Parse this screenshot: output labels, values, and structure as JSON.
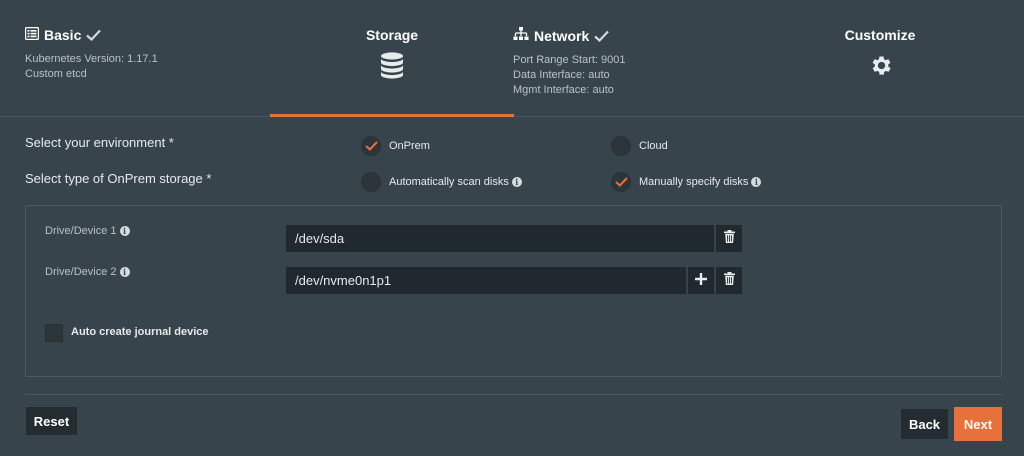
{
  "steps": [
    {
      "title": "Basic",
      "icon": "list-icon",
      "completed": true,
      "details": [
        "Kubernetes Version: 1.17.1",
        "Custom etcd"
      ]
    },
    {
      "title": "Storage",
      "icon": "database-icon",
      "active": true,
      "details": []
    },
    {
      "title": "Network",
      "icon": "sitemap-icon",
      "completed": true,
      "details": [
        "Port Range Start: 9001",
        "Data Interface: auto",
        "Mgmt Interface: auto"
      ]
    },
    {
      "title": "Customize",
      "icon": "gear-icon",
      "details": []
    }
  ],
  "environment": {
    "label": "Select your environment *",
    "options": [
      {
        "label": "OnPrem",
        "selected": true
      },
      {
        "label": "Cloud",
        "selected": false
      }
    ]
  },
  "storage_type": {
    "label": "Select type of OnPrem storage *",
    "options": [
      {
        "label": "Automatically scan disks",
        "selected": false,
        "info": true
      },
      {
        "label": "Manually specify disks",
        "selected": true,
        "info": true
      }
    ]
  },
  "devices": [
    {
      "label": "Drive/Device 1",
      "value": "/dev/sda"
    },
    {
      "label": "Drive/Device 2",
      "value": "/dev/nvme0n1p1"
    }
  ],
  "journal": {
    "label": "Auto create journal device",
    "checked": false
  },
  "buttons": {
    "reset": "Reset",
    "back": "Back",
    "next": "Next"
  },
  "colors": {
    "accent": "#e8703a",
    "background": "#38444b",
    "input": "#1f292e"
  }
}
